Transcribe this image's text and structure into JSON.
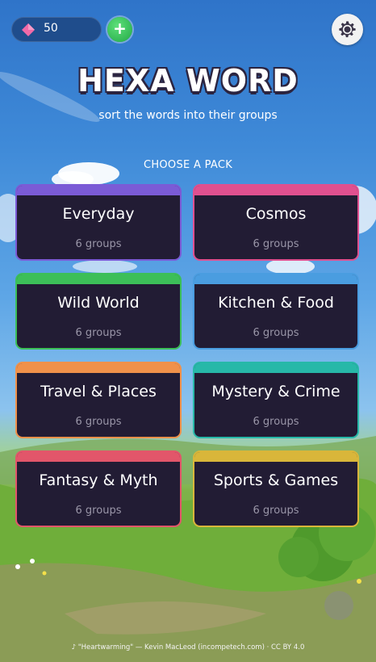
{
  "hud": {
    "gem_count": "50",
    "gem_icon": "gem-icon",
    "add_label": "+",
    "settings_icon": "gear-icon"
  },
  "title": "HEXA WORD",
  "subtitle": "sort the words into their groups",
  "section_label": "CHOOSE A PACK",
  "packs": [
    {
      "name": "Everyday",
      "count": "6 groups",
      "accent": "#7b5bd6"
    },
    {
      "name": "Cosmos",
      "count": "6 groups",
      "accent": "#e0508f"
    },
    {
      "name": "Wild World",
      "count": "6 groups",
      "accent": "#3cbf58"
    },
    {
      "name": "Kitchen & Food",
      "count": "6 groups",
      "accent": "#4a9de0"
    },
    {
      "name": "Travel & Places",
      "count": "6 groups",
      "accent": "#f0914a"
    },
    {
      "name": "Mystery & Crime",
      "count": "6 groups",
      "accent": "#27b8a8"
    },
    {
      "name": "Fantasy & Myth",
      "count": "6 groups",
      "accent": "#e2566a"
    },
    {
      "name": "Sports & Games",
      "count": "6 groups",
      "accent": "#d9b63a"
    }
  ],
  "credits": "♪ \"Heartwarming\" — Kevin MacLeod (incompetech.com) · CC BY 4.0"
}
